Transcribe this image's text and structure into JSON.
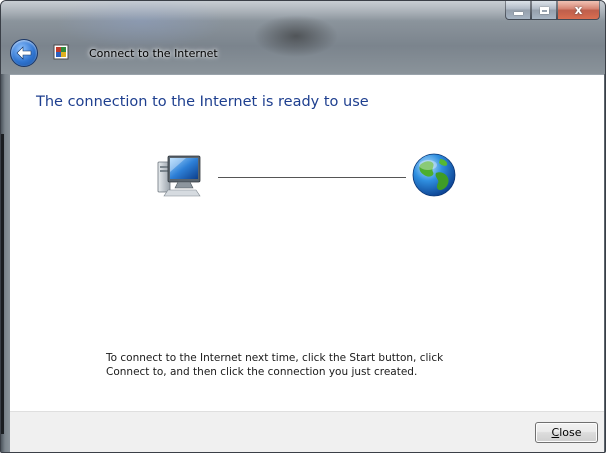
{
  "window": {
    "title": "Connect to the Internet",
    "controls": {
      "minimize_icon": "minimize-icon",
      "maximize_icon": "maximize-icon",
      "close_icon": "close-icon",
      "close_glyph": "x"
    }
  },
  "nav": {
    "back_icon": "back-arrow-icon",
    "app_icon": "network-wizard-icon"
  },
  "main": {
    "heading": "The connection to the Internet is ready to use",
    "diagram": {
      "left_icon": "computer-icon",
      "right_icon": "globe-icon"
    },
    "instructions_line1": "To connect to the Internet next time, click the Start button, click",
    "instructions_line2": "Connect to, and then click the connection you just created."
  },
  "footer": {
    "close_button": {
      "accesskey": "C",
      "rest": "lose"
    }
  },
  "colors": {
    "heading": "#1e3f8f",
    "close_button_red": "#c8604a",
    "back_button_blue": "#2f74d0"
  }
}
